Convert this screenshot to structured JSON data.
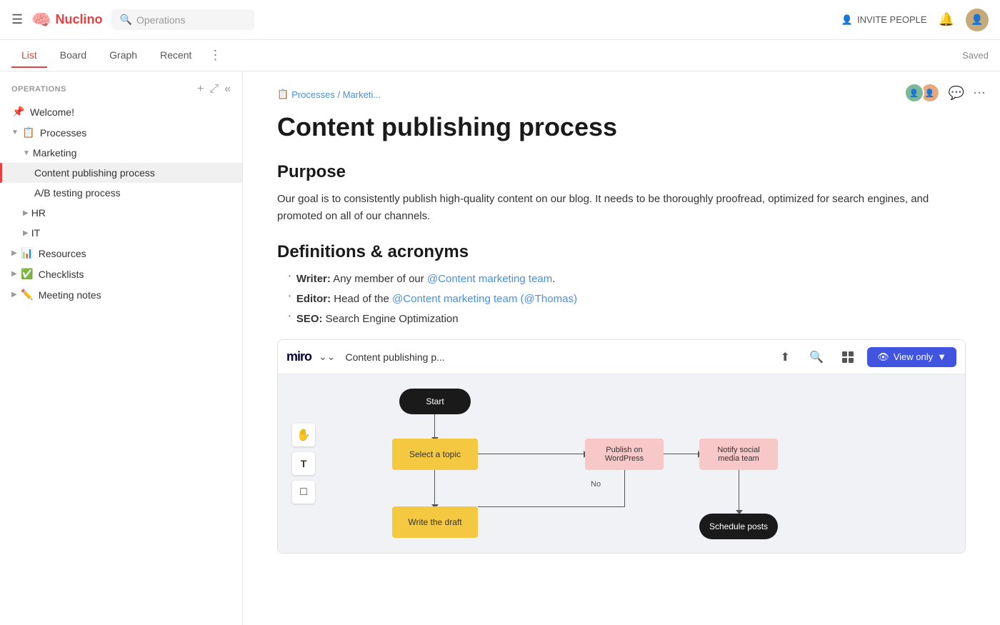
{
  "navbar": {
    "logo_text": "Nuclino",
    "workspace_title": "Operations",
    "search_placeholder": "Operations",
    "invite_label": "INVITE PEOPLE",
    "saved_label": "Saved"
  },
  "tabs": [
    {
      "label": "List",
      "active": true
    },
    {
      "label": "Board",
      "active": false
    },
    {
      "label": "Graph",
      "active": false
    },
    {
      "label": "Recent",
      "active": false
    }
  ],
  "sidebar": {
    "section_title": "OPERATIONS",
    "items": [
      {
        "label": "Welcome!",
        "icon": "📌",
        "indent": 0,
        "type": "pinned"
      },
      {
        "label": "Processes",
        "icon": "📋",
        "indent": 0,
        "chevron": "▼",
        "type": "group"
      },
      {
        "label": "Marketing",
        "icon": "",
        "indent": 1,
        "chevron": "▼",
        "type": "group"
      },
      {
        "label": "Content publishing process",
        "icon": "",
        "indent": 2,
        "active": true
      },
      {
        "label": "A/B testing process",
        "icon": "",
        "indent": 2
      },
      {
        "label": "HR",
        "icon": "",
        "indent": 1,
        "chevron": "▶",
        "type": "group"
      },
      {
        "label": "IT",
        "icon": "",
        "indent": 1,
        "chevron": "▶",
        "type": "group"
      },
      {
        "label": "Resources",
        "icon": "📊",
        "indent": 0,
        "chevron": "▶",
        "type": "group"
      },
      {
        "label": "Checklists",
        "icon": "✅",
        "indent": 0,
        "chevron": "▶",
        "type": "group"
      },
      {
        "label": "Meeting notes",
        "icon": "✏️",
        "indent": 0,
        "chevron": "▶",
        "type": "group"
      }
    ]
  },
  "content": {
    "breadcrumb": "Processes / Marketi...",
    "breadcrumb_icon": "📋",
    "page_title": "Content publishing process",
    "purpose_heading": "Purpose",
    "purpose_text": "Our goal is to consistently publish high-quality content on our blog. It needs to be thoroughly proofread, optimized for search engines, and promoted on all of our channels.",
    "definitions_heading": "Definitions & acronyms",
    "definitions": [
      {
        "term": "Writer:",
        "text": "Any member of our ",
        "link": "@Content marketing team",
        "after": "."
      },
      {
        "term": "Editor:",
        "text": "Head of the ",
        "link": "@Content marketing team",
        "link2": "(@Thomas)",
        "after": ""
      },
      {
        "term": "SEO:",
        "text": "Search Engine Optimization",
        "link": "",
        "after": ""
      }
    ]
  },
  "miro": {
    "logo": "miro",
    "title": "Content publishing p...",
    "view_only_label": "View only",
    "flowchart": {
      "nodes": [
        {
          "id": "start",
          "label": "Start",
          "type": "rounded-dark"
        },
        {
          "id": "select",
          "label": "Select a topic",
          "type": "yellow"
        },
        {
          "id": "write",
          "label": "Write the draft",
          "type": "yellow"
        },
        {
          "id": "publish",
          "label": "Publish on WordPress",
          "type": "pink"
        },
        {
          "id": "notify",
          "label": "Notify social media team",
          "type": "pink"
        },
        {
          "id": "schedule",
          "label": "Schedule posts",
          "type": "rounded-dark"
        }
      ],
      "labels": [
        {
          "id": "no",
          "label": "No"
        }
      ]
    }
  },
  "icons": {
    "hamburger": "☰",
    "brain": "🧠",
    "search": "🔍",
    "bell": "🔔",
    "chevron_down": "⌄",
    "more_dots": "⋯",
    "plus": "+",
    "expand": "⤢",
    "collapse": "«",
    "comment": "💬",
    "ellipsis": "⋯",
    "upload": "⬆",
    "magnify": "🔍",
    "apps": "⊞",
    "eye": "👁",
    "hand": "✋",
    "text_tool": "T",
    "sticky": "⬜"
  }
}
